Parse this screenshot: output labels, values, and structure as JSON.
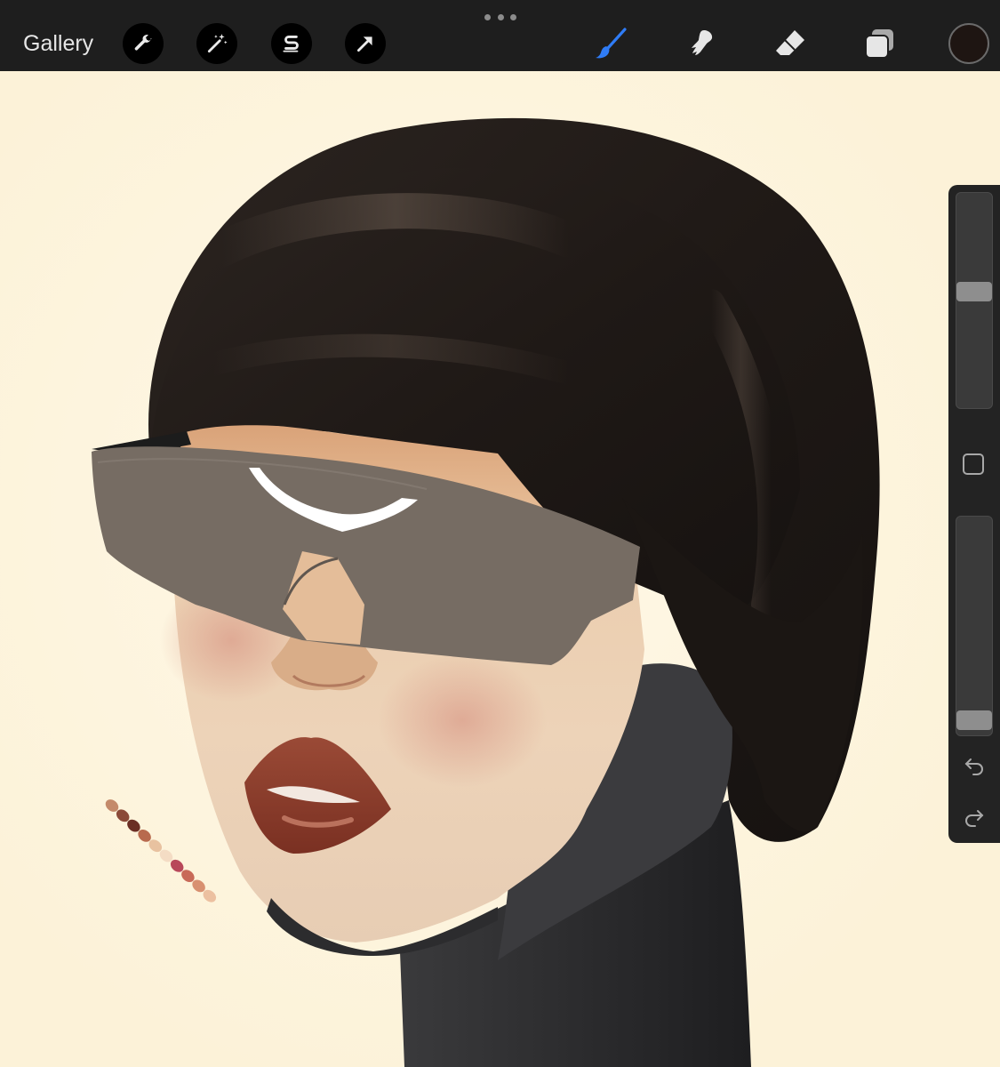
{
  "topbar": {
    "gallery_label": "Gallery",
    "left_tools": [
      {
        "icon": "wrench-icon",
        "name": "actions"
      },
      {
        "icon": "magic-wand-icon",
        "name": "adjustments"
      },
      {
        "icon": "selection-s-icon",
        "name": "selection"
      },
      {
        "icon": "arrow-cursor-icon",
        "name": "transform"
      }
    ],
    "right_tools": [
      {
        "icon": "brush-icon",
        "name": "paint",
        "active": true,
        "color": "#2f7cf6"
      },
      {
        "icon": "smudge-icon",
        "name": "smudge",
        "active": false
      },
      {
        "icon": "eraser-icon",
        "name": "erase",
        "active": false
      },
      {
        "icon": "layers-icon",
        "name": "layers",
        "active": false
      }
    ],
    "current_color": "#1e1512",
    "more_icon": "ellipsis-icon"
  },
  "sidebar": {
    "brush_size_level": 0.55,
    "brush_opacity_level": 0.0,
    "modify_icon": "square-icon",
    "undo_icon": "undo-icon",
    "redo_icon": "redo-icon"
  },
  "canvas": {
    "background": "#fdf5e0",
    "palette_swatches": [
      "#c48a6a",
      "#8b4a38",
      "#6b2f24",
      "#b86a4e",
      "#e8c2a0",
      "#f4dcc4",
      "#b8485a",
      "#c86a58",
      "#d89070",
      "#ecc0a0"
    ]
  }
}
